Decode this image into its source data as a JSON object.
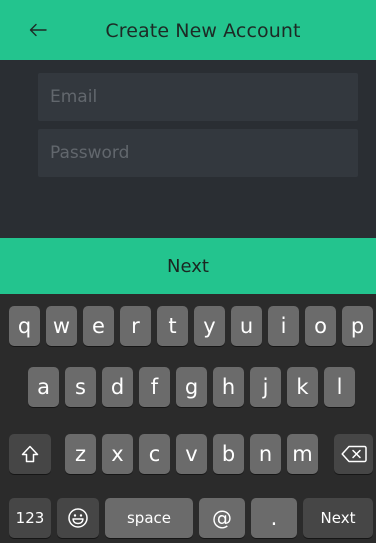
{
  "header": {
    "title": "Create New Account",
    "back_icon": "arrow-left-icon",
    "background": "#23c48e"
  },
  "form": {
    "email_placeholder": "Email",
    "email_value": "",
    "password_placeholder": "Password",
    "password_value": ""
  },
  "next_bar": {
    "label": "Next",
    "background": "#23c48e"
  },
  "keyboard": {
    "row1": [
      "q",
      "w",
      "e",
      "r",
      "t",
      "y",
      "u",
      "i",
      "o",
      "p"
    ],
    "row2": [
      "a",
      "s",
      "d",
      "f",
      "g",
      "h",
      "j",
      "k",
      "l"
    ],
    "row3": [
      "z",
      "x",
      "c",
      "v",
      "b",
      "n",
      "m"
    ],
    "shift_icon": "shift-icon",
    "delete_icon": "delete-icon",
    "numbers_label": "123",
    "emoji_icon": "emoji-icon",
    "space_label": "space",
    "at_label": "@",
    "period_label": ".",
    "return_label": "Next"
  }
}
